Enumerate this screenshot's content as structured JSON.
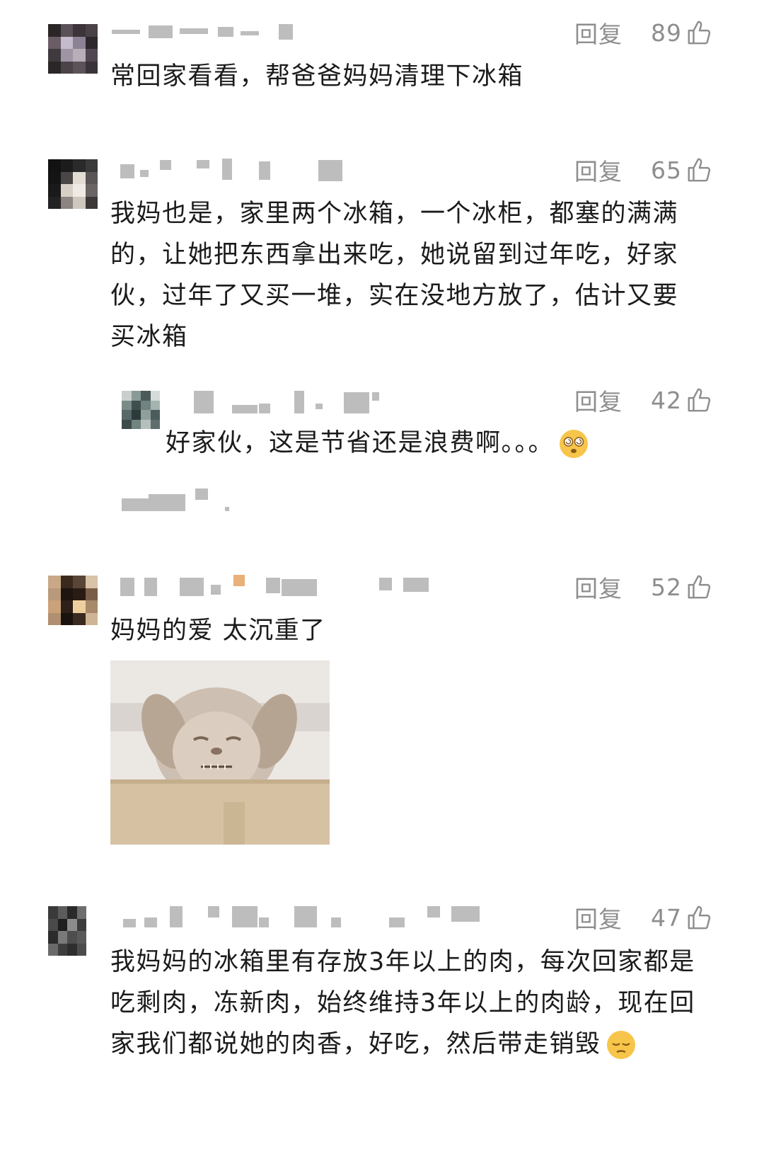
{
  "comments": [
    {
      "text": "常回家看看，帮爸爸妈妈清理下冰箱",
      "reply_label": "回复",
      "likes": "89"
    },
    {
      "text": "我妈也是，家里两个冰箱，一个冰柜，都塞的满满的，让她把东西拿出来吃，她说留到过年吃，好家伙，过年了又买一堆，实在没地方放了，估计又要买冰箱",
      "reply_label": "回复",
      "likes": "65",
      "reply": {
        "text": "好家伙，这是节省还是浪费啊。。。",
        "reply_label": "回复",
        "likes": "42",
        "emoji": "dizzy-face-emoji"
      }
    },
    {
      "text": "妈妈的爱 太沉重了",
      "reply_label": "回复",
      "likes": "52",
      "image": "squinting-dog-meme"
    },
    {
      "text": "我妈妈的冰箱里有存放3年以上的肉，每次回家都是吃剩肉，冻新肉，始终维持3年以上的肉龄，现在回家我们都说她的肉香，好吃，然后带走销毁",
      "reply_label": "回复",
      "likes": "47",
      "emoji": "pensive-face-emoji"
    }
  ],
  "colors": {
    "text": "#1b1b1b",
    "meta": "#8e8e8e",
    "blur": "#bdbdbd"
  }
}
